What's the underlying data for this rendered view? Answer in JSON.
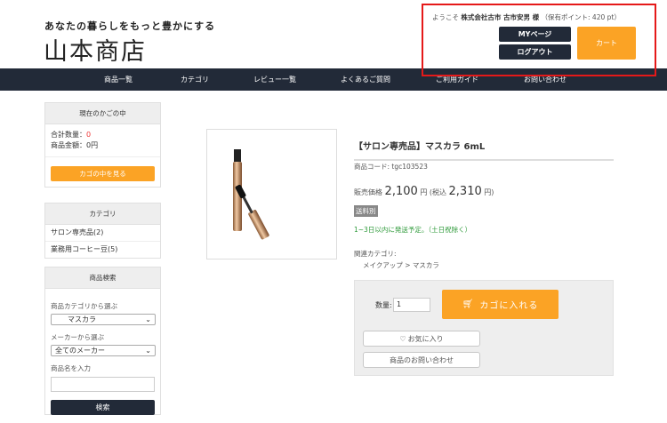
{
  "header": {
    "tagline": "あなたの暮らしをもっと豊かにする",
    "logo": "山本商店",
    "welcome_prefix": "ようこそ",
    "user_name": "株式会社古市 古市安男 様",
    "points": "（保有ポイント: 420 pt）",
    "mypage": "MYページ",
    "logout": "ログアウト",
    "cart": "カート"
  },
  "nav": [
    "商品一覧",
    "カテゴリ",
    "レビュー一覧",
    "よくあるご質問",
    "ご利用ガイド",
    "お問い合わせ"
  ],
  "cart_box": {
    "title": "現在のかごの中",
    "qty_label": "合計数量：",
    "qty_value": "0",
    "amount": "商品金額：0円",
    "view_button": "カゴの中を見る"
  },
  "category_box": {
    "title": "カテゴリ",
    "items": [
      "サロン専売品(2)",
      "業務用コーヒー豆(5)"
    ]
  },
  "search_box": {
    "title": "商品検索",
    "category_label": "商品カテゴリから選ぶ",
    "category_value": "マスカラ",
    "maker_label": "メーカーから選ぶ",
    "maker_value": "全てのメーカー",
    "name_label": "商品名を入力",
    "name_value": "",
    "search_button": "検索"
  },
  "product": {
    "title": "【サロン専売品】マスカラ 6mL",
    "code": "商品コード: tgc103523",
    "price_label": "販売価格",
    "price": "2,100",
    "yen": "円",
    "tax_label": "(税込",
    "tax_price": "2,310",
    "tax_close": "円)",
    "shipping_badge": "送料別",
    "delivery": "1~3日以内に発送予定。（土日祝除く）",
    "related_label": "関連カテゴリ:",
    "related_path": "メイクアップ > マスカラ"
  },
  "purchase": {
    "qty_label": "数量:",
    "qty_value": "1",
    "add_to_cart": "カゴに入れる",
    "favorite": "お気に入り",
    "inquiry": "商品のお問い合わせ"
  },
  "colors": {
    "accent": "#fba325",
    "dark": "#222a38",
    "green": "#2e9a3a"
  }
}
